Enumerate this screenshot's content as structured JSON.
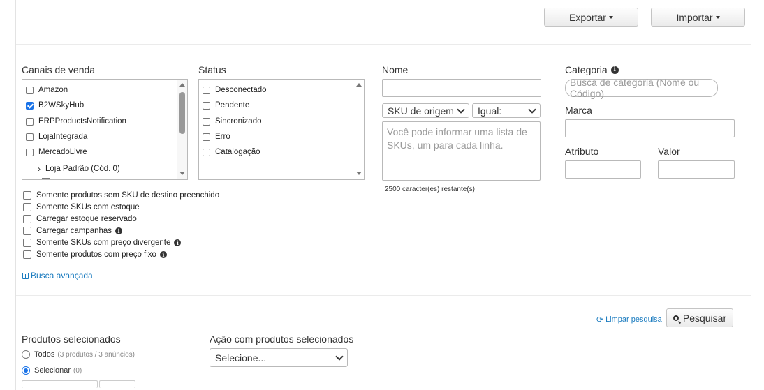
{
  "toolbar": {
    "export_label": "Exportar",
    "import_label": "Importar"
  },
  "channels": {
    "label": "Canais de venda",
    "items": [
      {
        "label": "Amazon",
        "checked": false
      },
      {
        "label": "B2WSkyHub",
        "checked": true
      },
      {
        "label": "ERPProductsNotification",
        "checked": false
      },
      {
        "label": "LojaIntegrada",
        "checked": false
      },
      {
        "label": "MercadoLivre",
        "checked": false
      }
    ],
    "sub_item": "Loja Padrão (Cód. 0)"
  },
  "status": {
    "label": "Status",
    "items": [
      "Desconectado",
      "Pendente",
      "Sincronizado",
      "Erro",
      "Catalogação"
    ]
  },
  "name_filter": {
    "label": "Nome",
    "sku_select": "SKU de origem",
    "op_select": "Igual:",
    "sku_placeholder": "Você pode informar uma lista de SKUs, um para cada linha.",
    "remaining": "2500 caracter(es) restante(s)"
  },
  "category": {
    "label": "Categoria",
    "placeholder": "Busca de categoria (Nome ou Código)",
    "brand_label": "Marca",
    "attribute_label": "Atributo",
    "value_label": "Valor"
  },
  "options": [
    {
      "label": "Somente produtos sem SKU de destino preenchido",
      "info": false
    },
    {
      "label": "Somente SKUs com estoque",
      "info": false
    },
    {
      "label": "Carregar estoque reservado",
      "info": false
    },
    {
      "label": "Carregar campanhas",
      "info": true
    },
    {
      "label": "Somente SKUs com preço divergente",
      "info": true
    },
    {
      "label": "Somente produtos com preço fixo",
      "info": true
    }
  ],
  "advanced_search": "Busca avançada",
  "clear_search": "Limpar pesquisa",
  "search_button": "Pesquisar",
  "selected_products": {
    "label": "Produtos selecionados",
    "all_label": "Todos",
    "all_count": "(3 produtos / 3 anúncios)",
    "select_label": "Selecionar",
    "select_count": "(0)"
  },
  "action": {
    "label": "Ação com produtos selecionados",
    "select_value": "Selecione..."
  },
  "colors": {
    "accent": "#1a73e8",
    "link": "#1a7bbf"
  }
}
